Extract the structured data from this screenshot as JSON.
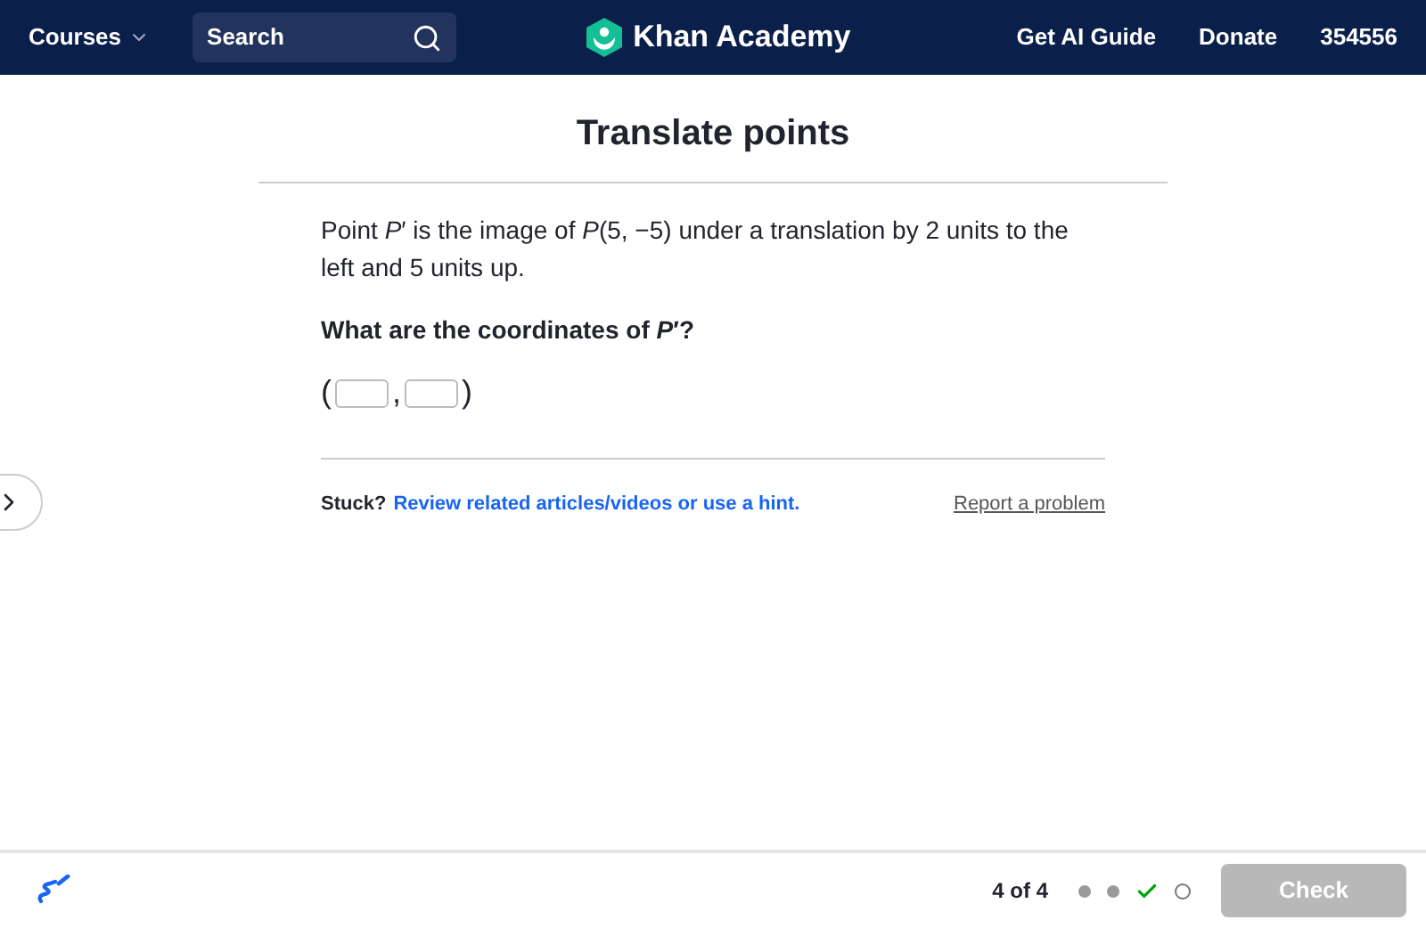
{
  "nav": {
    "courses": "Courses",
    "search": {
      "placeholder": "Search"
    },
    "logo": "Khan Academy",
    "links": [
      "Get AI Guide",
      "Donate",
      "354556"
    ]
  },
  "title": "Translate points",
  "question": {
    "prompt": "Point *P*′ is the image of *P*(5, −5) under a translation by 2 units to the left and 5 units up.",
    "ask": "What are the coordinates of *P*′?",
    "open": "(",
    "comma": ",",
    "close": ")"
  },
  "help": {
    "stuck": "Stuck?",
    "hint_link": "Review related articles/videos or use a hint.",
    "report": "Report a problem"
  },
  "footer": {
    "counter": "4 of 4",
    "progress": [
      {
        "kind": "done"
      },
      {
        "kind": "done"
      },
      {
        "kind": "correct"
      },
      {
        "kind": "current"
      }
    ],
    "check": {
      "label": "Check",
      "disabled": true
    }
  }
}
